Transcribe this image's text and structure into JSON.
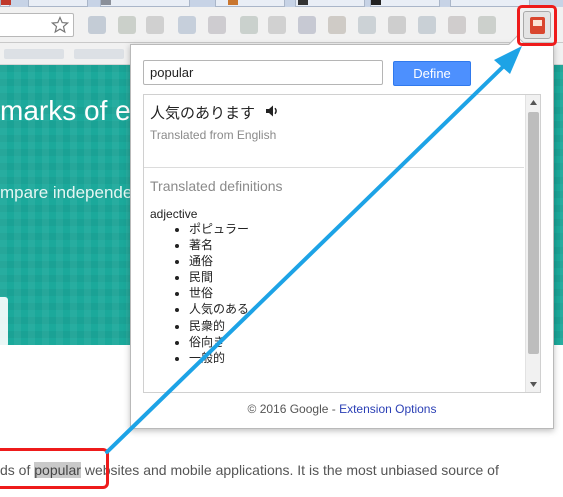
{
  "popup": {
    "input_value": "popular",
    "define_label": "Define",
    "translation": "人気のあります",
    "translated_from": "Translated from English",
    "definitions_heading": "Translated definitions",
    "part_of_speech": "adjective",
    "definitions": [
      "ポピュラー",
      "著名",
      "通俗",
      "民間",
      "世俗",
      "人気のある",
      "民衆的",
      "俗向き",
      "一般的"
    ],
    "footer_text": "© 2016 Google - ",
    "footer_link": "Extension Options"
  },
  "page": {
    "hero_title": "marks of ev",
    "hero_subtitle": "mpare independe",
    "body_before": "ds of ",
    "body_word": "popular",
    "body_after": " websites and mobile applications. It is the most unbiased source of"
  },
  "colors": {
    "annotation_red": "#ee1b1b",
    "arrow_blue": "#1da3e6",
    "hero_teal": "#1ba99b",
    "define_blue": "#4d90fe",
    "link_blue": "#2a3fb5"
  },
  "icons": {
    "extension": "google-dictionary-book-icon",
    "bookmark": "star-icon",
    "audio": "speaker-icon"
  }
}
